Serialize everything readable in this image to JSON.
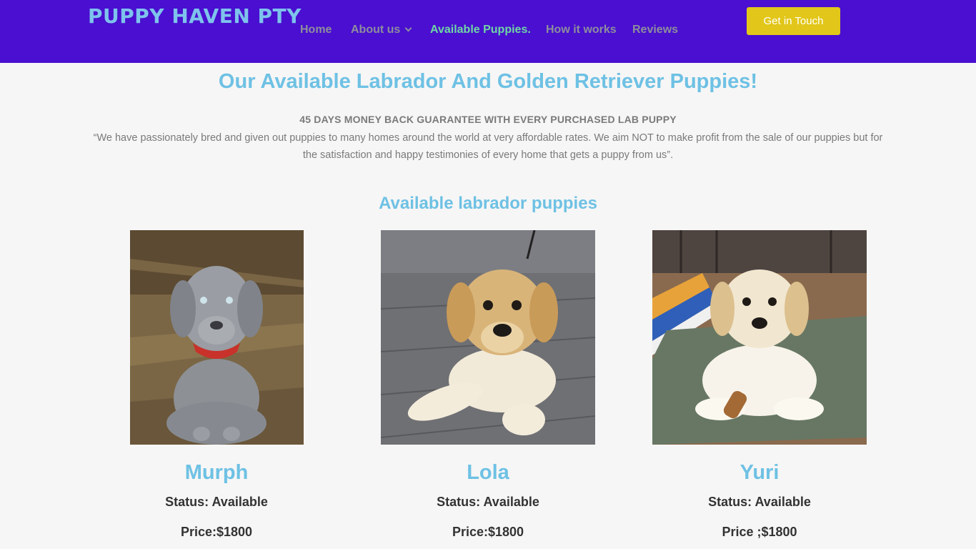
{
  "header": {
    "logo": "PUPPY HAVEN PTY",
    "nav": [
      {
        "label": "Home",
        "active": false
      },
      {
        "label": "About us",
        "active": false,
        "has_dropdown": true
      },
      {
        "label": "Available Puppies.",
        "active": true
      },
      {
        "label": "How it works",
        "active": false
      },
      {
        "label": "Reviews",
        "active": false
      }
    ],
    "cta_label": "Get in Touch"
  },
  "colors": {
    "header_bg": "#4a0fd0",
    "accent_blue": "#6ec1e4",
    "active_nav": "#6fd6a6",
    "cta_bg": "#e2c71a"
  },
  "main": {
    "title": "Our Available Labrador And Golden Retriever Puppies!",
    "guarantee": "45 DAYS MONEY BACK GUARANTEE WITH EVERY PURCHASED  LAB PUPPY",
    "intro": "“We have passionately bred and given out puppies to many homes around the world at very affordable rates. We aim NOT to make profit from the sale of our puppies but for the satisfaction and happy testimonies of every home that gets a puppy from us”.",
    "section_title": "Available labrador puppies",
    "puppies": [
      {
        "name": "Murph",
        "status": "Status: Available",
        "price": "Price:$1800",
        "photo": "silver-labrador-puppy-photo"
      },
      {
        "name": "Lola",
        "status": "Status: Available",
        "price": "Price:$1800",
        "photo": "yellow-labrador-puppy-photo"
      },
      {
        "name": "Yuri",
        "status": "Status: Available",
        "price": "Price ;$1800",
        "photo": "cream-labrador-puppy-photo"
      }
    ]
  }
}
